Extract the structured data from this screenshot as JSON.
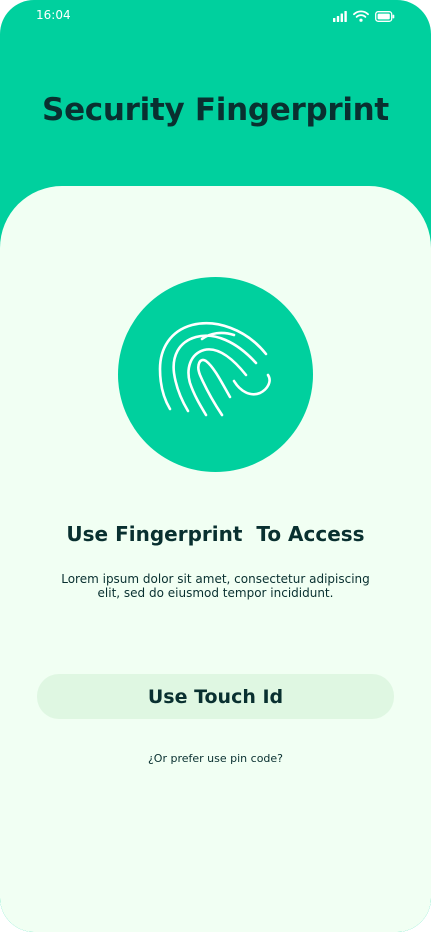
{
  "status_bar": {
    "time": "16:04",
    "icons": [
      "signal-icon",
      "wifi-icon",
      "battery-icon"
    ]
  },
  "header": {
    "title": "Security Fingerprint"
  },
  "main": {
    "icon": "fingerprint-icon",
    "access_title": "Use Fingerprint  To Access",
    "description": "Lorem ipsum dolor sit amet, consectetur adipiscing elit, sed do eiusmod tempor incididunt.",
    "touch_id_label": "Use Touch Id",
    "pin_code_link": "¿Or prefer use pin code?"
  },
  "colors": {
    "brand": "#00D09E",
    "sheet": "#F1FFF3",
    "text": "#093030",
    "button": "#DFF7E2"
  }
}
